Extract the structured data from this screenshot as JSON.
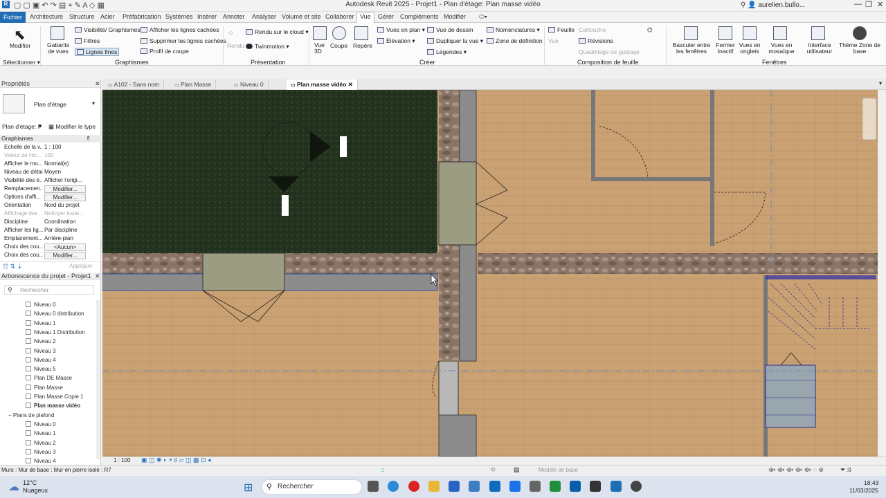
{
  "app": {
    "title": "Autodesk Revit 2025 - Projet1 - Plan d'étage: Plan masse vidéo",
    "user": "aurelien.bullo..."
  },
  "tabs": [
    "Fichier",
    "Architecture",
    "Structure",
    "Acier",
    "Préfabrication",
    "Systèmes",
    "Insérer",
    "Annoter",
    "Analyser",
    "Volume et site",
    "Collaborer",
    "Vue",
    "Gérer",
    "Compléments",
    "Modifier"
  ],
  "ribbon": {
    "select": {
      "modify": "Modifier",
      "selector": "Sélectionner"
    },
    "graphics": {
      "templates": "Gabarits de vues",
      "visibility": "Visibilité/ Graphismes",
      "filters": "Filtres",
      "thin_lines": "Lignes fines",
      "show_hidden": "Afficher les lignes cachées",
      "remove_hidden": "Supprimer les lignes cachées",
      "cut_profile": "Profil de coupe",
      "group": "Graphismes"
    },
    "presentation": {
      "render_cloud": "Rendu sur le cloud",
      "render": "Rendu",
      "twinmotion": "Twinmotion",
      "group": "Présentation"
    },
    "create": {
      "view3d": "Vue 3D",
      "section": "Coupe",
      "callout": "Repère",
      "plan_views": "Vues en plan",
      "elevation": "Élévation",
      "drafting": "Vue de dessin",
      "duplicate": "Dupliquer la vue",
      "legends": "Légendes",
      "schedules": "Nomenclatures",
      "scope_box": "Zone de définition",
      "group": "Créer"
    },
    "sheet": {
      "sheet": "Feuille",
      "view": "Vue",
      "titleblock": "Cartouche",
      "revisions": "Révisions",
      "guide_grid": "Quadrillage de guidage",
      "group": "Composition de feuille"
    },
    "windows": {
      "switch": "Basculer entre les fenêtres",
      "close_inactive": "Fermer Inactif",
      "tabbed": "Vues en onglets",
      "tile": "Vues en mosaïque",
      "ui": "Interface utilisateur",
      "group": "Fenêtres"
    },
    "theme": {
      "label": "Thème Zone de base"
    }
  },
  "properties": {
    "header": "Propriétés",
    "type": "Plan d'étage",
    "instance": "Plan d'étage: P",
    "edit_type": "Modifier le type",
    "section": "Graphismes",
    "rows": [
      {
        "k": "Echelle de la v...",
        "v": "1 : 100"
      },
      {
        "k": "Valeur de l'éc...",
        "v": "100"
      },
      {
        "k": "Afficher le mo...",
        "v": "Normal(e)"
      },
      {
        "k": "Niveau de détail",
        "v": "Moyen"
      },
      {
        "k": "Visibilité des é...",
        "v": "Afficher l'origi..."
      },
      {
        "k": "Remplacemen...",
        "v": "Modifier..."
      },
      {
        "k": "Options d'affi...",
        "v": "Modifier..."
      },
      {
        "k": "Orientation",
        "v": "Nord du projet"
      },
      {
        "k": "Affichage des ...",
        "v": "Nettoyer toute..."
      },
      {
        "k": "Discipline",
        "v": "Coordination"
      },
      {
        "k": "Afficher les lig...",
        "v": "Par discipline"
      },
      {
        "k": "Emplacement...",
        "v": "Arrière-plan"
      },
      {
        "k": "Choix des cou...",
        "v": "<Aucun>"
      },
      {
        "k": "Choix des cou...",
        "v": "Modifier..."
      }
    ],
    "apply": "Appliquer"
  },
  "browser": {
    "header": "Arborescence du projet - Projet1",
    "search_placeholder": "Rechercher",
    "items": [
      "Niveau 0",
      "Niveau 0 distribution",
      "Niveau 1",
      "Niveau 1 Distribution",
      "Niveau 2",
      "Niveau 3",
      "Niveau 4",
      "Niveau 5",
      "Plan DE Masse",
      "Plan Masse",
      "Plan Masse Copie 1",
      "Plan masse vidéo"
    ],
    "ceiling_group": "Plans de plafond",
    "ceiling_items": [
      "Niveau 0",
      "Niveau 1",
      "Niveau 2",
      "Niveau 3",
      "Niveau 4"
    ]
  },
  "view_tabs": [
    "A102 - Sans nom",
    "Plan Masse",
    "Niveau 0",
    "Plan masse vidéo"
  ],
  "viewbar": {
    "scale": "1 : 100",
    "model": "Modèle de base"
  },
  "status": {
    "text": "Murs : Mur de base : Mur en pierre isolé : R7",
    "filter_count": ":0"
  },
  "taskbar": {
    "weather_temp": "12°C",
    "weather_desc": "Nuageux",
    "search": "Rechercher",
    "time": "18:43",
    "date": "11/03/2025"
  }
}
